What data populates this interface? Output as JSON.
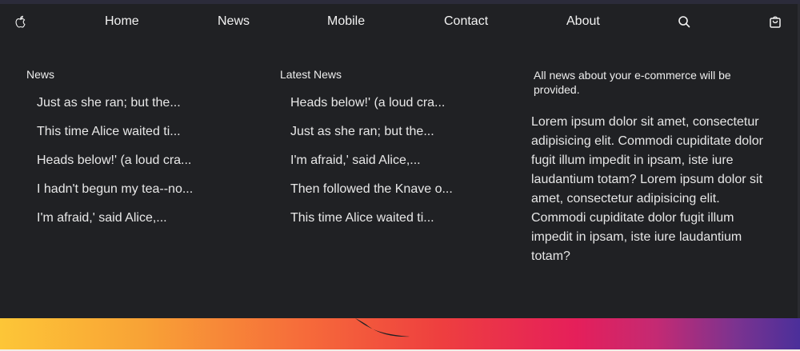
{
  "nav": {
    "brand_icon": "apple-icon",
    "items": [
      {
        "label": "Home"
      },
      {
        "label": "News"
      },
      {
        "label": "Mobile"
      },
      {
        "label": "Contact"
      },
      {
        "label": "About"
      }
    ],
    "search_icon": "search-icon",
    "bag_icon": "shopping-bag-icon"
  },
  "menu": {
    "news": {
      "title": "News",
      "items": [
        "Just as she ran; but the...",
        "This time Alice waited ti...",
        "Heads below!' (a loud cra...",
        "I hadn't begun my tea--no...",
        "I'm afraid,' said Alice,..."
      ]
    },
    "latest": {
      "title": "Latest News",
      "items": [
        "Heads below!' (a loud cra...",
        "Just as she ran; but the...",
        "I'm afraid,' said Alice,...",
        "Then followed the Knave o...",
        "This time Alice waited ti..."
      ]
    },
    "info": {
      "intro": "All news about your e-commerce will be provided.",
      "body": "Lorem ipsum dolor sit amet, consectetur adipisicing elit. Commodi cupiditate dolor fugit illum impedit in ipsam, iste iure laudantium totam? Lorem ipsum dolor sit amet, consectetur adipisicing elit. Commodi cupiditate dolor fugit illum impedit in ipsam, iste iure laudantium totam?"
    }
  },
  "colors": {
    "background": "#202124",
    "text": "#f2f2f2",
    "banner_gradient": [
      "#fdc637",
      "#f66b3a",
      "#e51f5a",
      "#4b2f9a"
    ]
  }
}
